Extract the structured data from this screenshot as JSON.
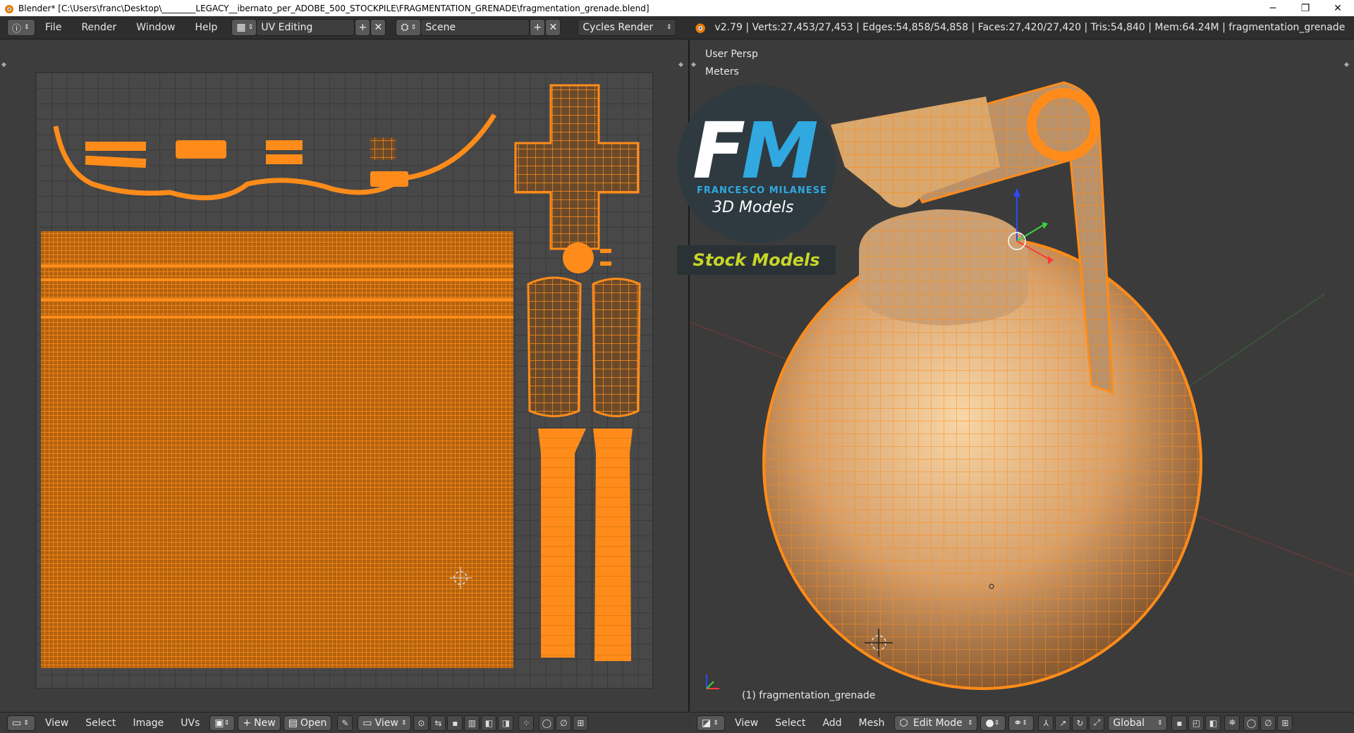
{
  "window": {
    "title": "Blender* [C:\\Users\\franc\\Desktop\\________LEGACY__ibernato_per_ADOBE_500_STOCKPILE\\FRAGMENTATION_GRENADE\\fragmentation_grenade.blend]",
    "minimize": "─",
    "restore": "❐",
    "close": "✕"
  },
  "header": {
    "menu": [
      "File",
      "Render",
      "Window",
      "Help"
    ],
    "screen_layout": "UV Editing",
    "scene": "Scene",
    "render_engine": "Cycles Render",
    "stats": "v2.79 | Verts:27,453/27,453 | Edges:54,858/54,858 | Faces:27,420/27,420 | Tris:54,840 | Mem:64.24M | fragmentation_grenade"
  },
  "viewport": {
    "view_name": "User Persp",
    "units": "Meters",
    "object_label": "(1) fragmentation_grenade"
  },
  "logo": {
    "f": "F",
    "m": "M",
    "name": "FRANCESCO MILANESE",
    "sub": "3D Models",
    "stock": "Stock Models"
  },
  "uv_bottom": {
    "items": [
      "View",
      "Select",
      "Image",
      "UVs"
    ],
    "new_label": "New",
    "open_label": "Open",
    "view_label": "View"
  },
  "vp_bottom": {
    "items": [
      "View",
      "Select",
      "Add",
      "Mesh"
    ],
    "mode": "Edit Mode",
    "orientation": "Global"
  },
  "colors": {
    "accent": "#ff8c1a",
    "mesh_fill": "#e8a85a",
    "bg": "#393939"
  }
}
